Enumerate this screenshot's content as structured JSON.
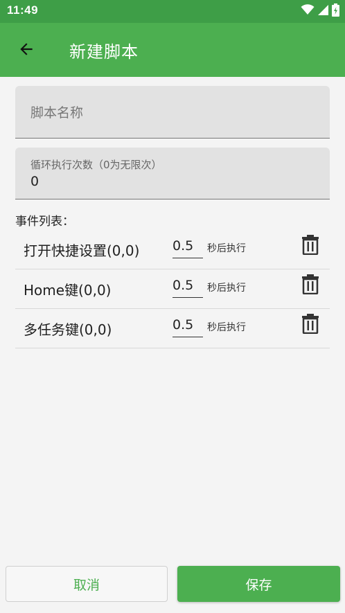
{
  "status_bar": {
    "time": "11:49",
    "icons": [
      "wifi-icon",
      "signal-icon",
      "battery-charging-icon"
    ]
  },
  "app_bar": {
    "title": "新建脚本",
    "back_icon": "arrow-left-icon"
  },
  "form": {
    "script_name": {
      "placeholder": "脚本名称",
      "value": ""
    },
    "loop_count": {
      "label": "循环执行次数（0为无限次）",
      "value": "0"
    }
  },
  "events": {
    "title": "事件列表：",
    "items": [
      {
        "name": "打开快捷设置(0,0)",
        "delay": "0.5",
        "suffix": "秒后执行"
      },
      {
        "name": "Home键(0,0)",
        "delay": "0.5",
        "suffix": "秒后执行"
      },
      {
        "name": "多任务键(0,0)",
        "delay": "0.5",
        "suffix": "秒后执行"
      }
    ]
  },
  "buttons": {
    "cancel": "取消",
    "save": "保存"
  },
  "colors": {
    "primary": "#4caf50",
    "status_bar": "#3e9e47",
    "background": "#f4f4f4"
  }
}
